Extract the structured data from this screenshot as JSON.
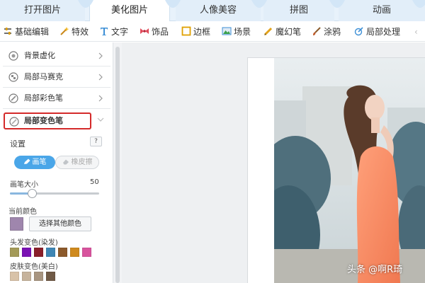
{
  "tabs": [
    {
      "label": "打开图片",
      "active": false
    },
    {
      "label": "美化图片",
      "active": true
    },
    {
      "label": "人像美容",
      "active": false
    },
    {
      "label": "拼图",
      "active": false
    },
    {
      "label": "动画",
      "active": false
    }
  ],
  "toolbar": [
    {
      "label": "基础编辑",
      "icon": "adjust-icon"
    },
    {
      "label": "特效",
      "icon": "magic-wand-icon"
    },
    {
      "label": "文字",
      "icon": "text-icon"
    },
    {
      "label": "饰品",
      "icon": "bow-icon"
    },
    {
      "label": "边框",
      "icon": "frame-icon"
    },
    {
      "label": "场景",
      "icon": "scene-icon"
    },
    {
      "label": "魔幻笔",
      "icon": "magic-pen-icon"
    },
    {
      "label": "涂鸦",
      "icon": "brush-icon"
    },
    {
      "label": "局部处理",
      "icon": "local-edit-icon"
    }
  ],
  "sidebar": {
    "items": [
      {
        "label": "背景虚化",
        "icon": "blur-icon"
      },
      {
        "label": "局部马赛克",
        "icon": "mosaic-icon"
      },
      {
        "label": "局部彩色笔",
        "icon": "color-pen-icon"
      },
      {
        "label": "局部变色笔",
        "icon": "recolor-pen-icon",
        "expanded": true
      }
    ],
    "settings": {
      "title": "设置",
      "help": "?",
      "pen_label": "画笔",
      "eraser_label": "橡皮擦",
      "brush_size_label": "画笔大小",
      "brush_size_value": "50",
      "brush_size_fraction": 0.25,
      "current_color_label": "当前颜色",
      "current_color": "#9f86ad",
      "choose_color_label": "选择其他颜色",
      "hair_label": "头发变色(染发)",
      "hair_colors": [
        "#a39a58",
        "#7a12b4",
        "#8a1f2a",
        "#3f86b4",
        "#8c5a2b",
        "#cf8a1e",
        "#d8549e"
      ],
      "skin_label": "皮肤变色(美白)",
      "skin_colors": [
        "#d8c2a8",
        "#c6b39c",
        "#a89580",
        "#705a46"
      ]
    }
  },
  "watermark": "头条 @啊R琦",
  "colors": {
    "accent": "#4aa6e8",
    "highlight_border": "#d42a2a",
    "tab_bar": "#e8f2fb"
  }
}
